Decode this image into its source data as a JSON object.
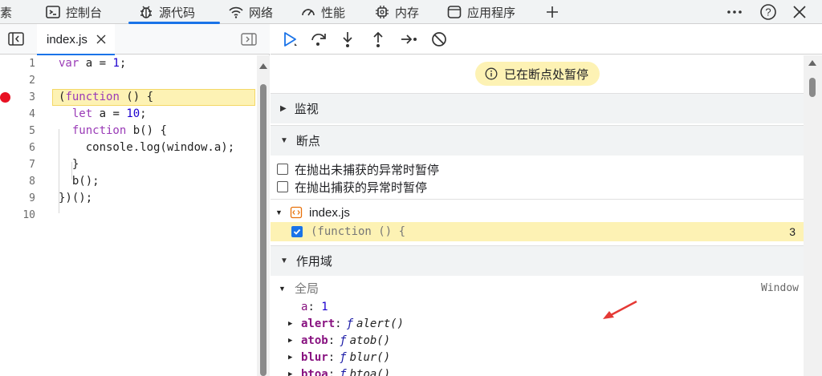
{
  "top_tabs": [
    {
      "label": "素",
      "icon": "none"
    },
    {
      "label": "控制台",
      "icon": "console-icon"
    },
    {
      "label": "源代码",
      "icon": "bug-icon",
      "active": true
    },
    {
      "label": "网络",
      "icon": "wifi-icon"
    },
    {
      "label": "性能",
      "icon": "gauge-icon"
    },
    {
      "label": "内存",
      "icon": "chip-icon"
    },
    {
      "label": "应用程序",
      "icon": "app-window-icon"
    }
  ],
  "top_right": {
    "add": "+",
    "more": "more-icon",
    "help": "?",
    "close": "close-icon"
  },
  "file_tab": {
    "name": "index.js"
  },
  "code_lines": [
    {
      "n": "1",
      "text": "var a = 1;"
    },
    {
      "n": "2",
      "text": ""
    },
    {
      "n": "3",
      "text": "(function () {"
    },
    {
      "n": "4",
      "text": "  let a = 10;"
    },
    {
      "n": "5",
      "text": "  function b() {"
    },
    {
      "n": "6",
      "text": "    console.log(window.a);"
    },
    {
      "n": "7",
      "text": "  }"
    },
    {
      "n": "8",
      "text": "  b();"
    },
    {
      "n": "9",
      "text": "})();"
    },
    {
      "n": "10",
      "text": ""
    }
  ],
  "paused_text": "已在断点处暂停",
  "sections": {
    "watch": "监视",
    "breakpoints": "断点",
    "scope": "作用域"
  },
  "exception_options": [
    {
      "label": "在抛出未捕获的异常时暂停",
      "checked": false
    },
    {
      "label": "在抛出捕获的异常时暂停",
      "checked": false
    }
  ],
  "breakpoint_file": "index.js",
  "breakpoint_item": {
    "code": "(function () {",
    "line": "3",
    "checked": true
  },
  "scope": {
    "global_label": "全局",
    "global_value": "Window",
    "props": [
      {
        "name": "a",
        "value": "1",
        "expandable": false
      },
      {
        "name": "alert",
        "fn": "alert()",
        "expandable": true
      },
      {
        "name": "atob",
        "fn": "atob()",
        "expandable": true
      },
      {
        "name": "blur",
        "fn": "blur()",
        "expandable": true
      },
      {
        "name": "btoa",
        "fn": "btoa()",
        "expandable": true
      }
    ]
  },
  "colors": {
    "accent": "#1a73e8",
    "highlight": "#fdf2b4",
    "breakpoint": "#e81123",
    "annotation_arrow": "#e53935"
  }
}
